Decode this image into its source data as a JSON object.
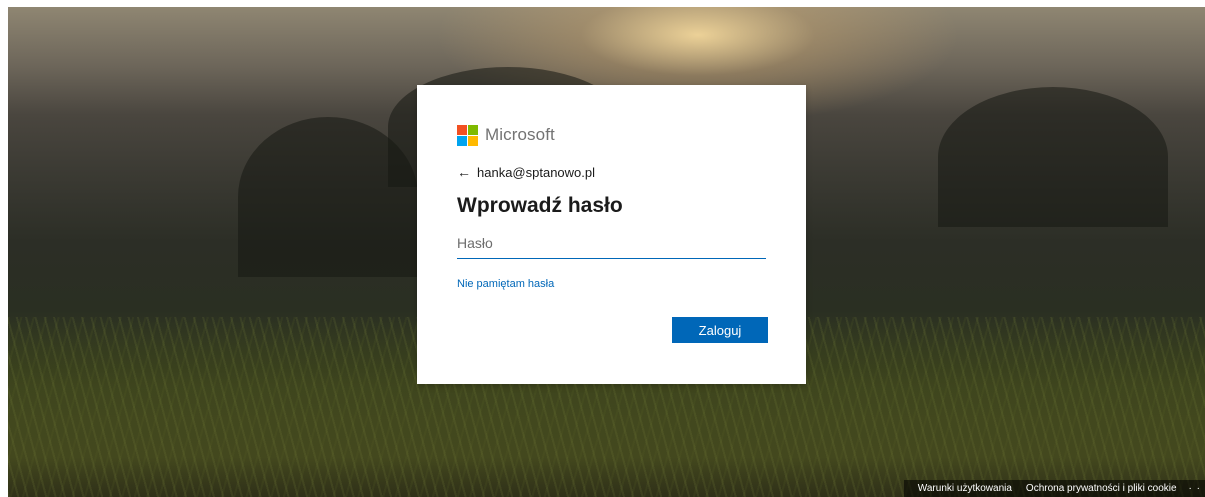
{
  "brand": {
    "name": "Microsoft",
    "colors": [
      "#f25022",
      "#7fba00",
      "#00a4ef",
      "#ffb900"
    ]
  },
  "identity": {
    "back_icon": "arrow-left-icon",
    "email": "hanka@sptanowo.pl"
  },
  "form": {
    "title": "Wprowadź hasło",
    "password_value": "",
    "password_placeholder": "Hasło",
    "forgot_link": "Nie pamiętam hasła",
    "submit_label": "Zaloguj"
  },
  "footer": {
    "terms": "Warunki użytkowania",
    "privacy": "Ochrona prywatności i pliki cookie",
    "more": "· ·"
  },
  "theme": {
    "accent": "#0067b8",
    "text": "#1b1b1b",
    "muted": "#737373"
  }
}
